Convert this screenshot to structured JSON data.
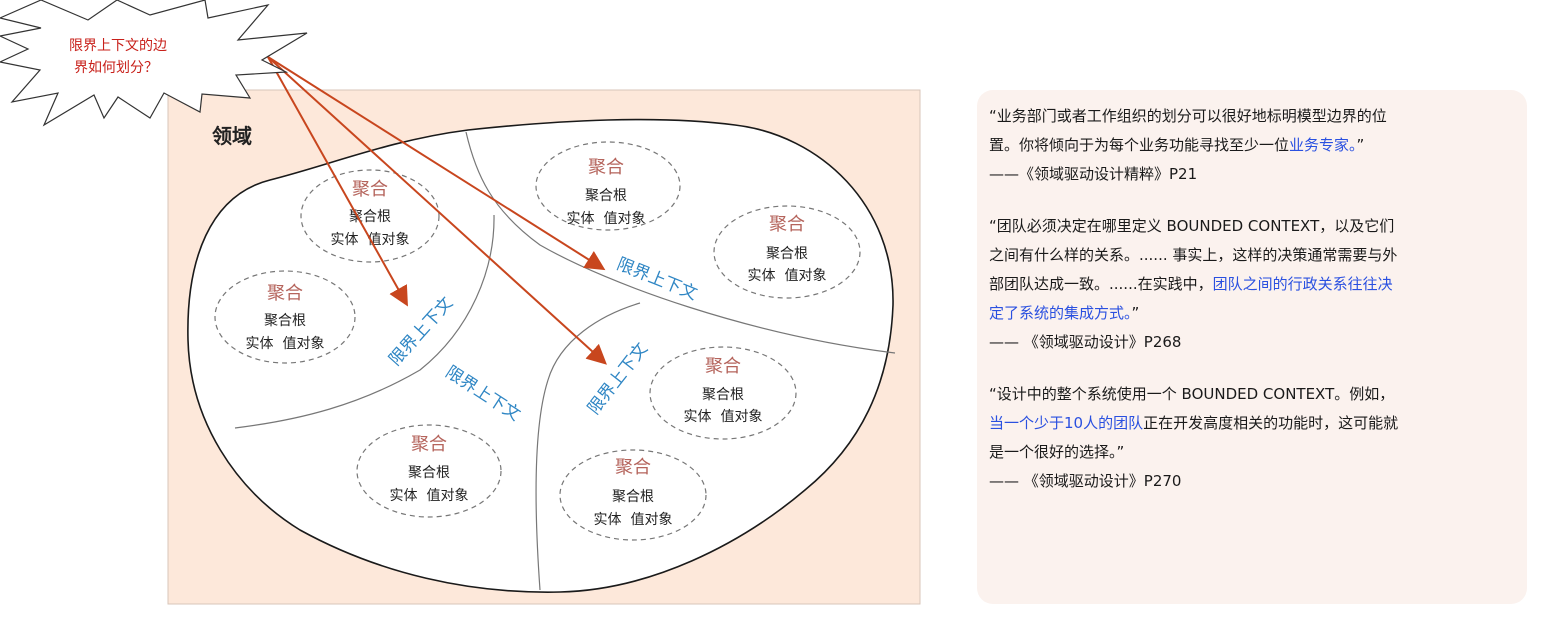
{
  "callout": {
    "lines": [
      "限界上下文的边",
      "界如何划分？"
    ]
  },
  "domain": {
    "label": "领域"
  },
  "aggregates": [
    {
      "title": "聚合",
      "root": "聚合根",
      "members": "实体  值对象"
    },
    {
      "title": "聚合",
      "root": "聚合根",
      "members": "实体  值对象"
    },
    {
      "title": "聚合",
      "root": "聚合根",
      "members": "实体  值对象"
    },
    {
      "title": "聚合",
      "root": "聚合根",
      "members": "实体  值对象"
    },
    {
      "title": "聚合",
      "root": "聚合根",
      "members": "实体  值对象"
    },
    {
      "title": "聚合",
      "root": "聚合根",
      "members": "实体  值对象"
    },
    {
      "title": "聚合",
      "root": "聚合根",
      "members": "实体  值对象"
    }
  ],
  "contexts": [
    "限界上下文",
    "限界上下文",
    "限界上下文",
    "限界上下文"
  ],
  "colors": {
    "domain_bg": "#fde8da",
    "arrow": "#c8461e",
    "aggregate_title": "#b5645c",
    "context_label": "#2f86c4",
    "callout_text": "#c8201a",
    "quote_highlight": "#2a50e0",
    "quote_panel_bg": "#fbf2ee"
  },
  "quotes": [
    {
      "lines": [
        [
          {
            "t": "“业务部门或者工作组织的划分可以很好地标明模型边界的位"
          }
        ],
        [
          {
            "t": "置。你将倾向于为每个业务功能寻找至少一位"
          },
          {
            "t": "业务专家。",
            "hl": true
          },
          {
            "t": "”"
          }
        ]
      ],
      "source": "——《领域驱动设计精粹》P21"
    },
    {
      "lines": [
        [
          {
            "t": "“团队必须决定在哪里定义 BOUNDED CONTEXT，以及它们"
          }
        ],
        [
          {
            "t": "之间有什么样的关系。...... 事实上，这样的决策通常需要与外"
          }
        ],
        [
          {
            "t": "部团队达成一致。......在实践中，"
          },
          {
            "t": "团队之间的行政关系往往决",
            "hl": true
          }
        ],
        [
          {
            "t": "定了系统的集成方式。",
            "hl": true
          },
          {
            "t": "”"
          }
        ]
      ],
      "source": "—— 《领域驱动设计》P268"
    },
    {
      "lines": [
        [
          {
            "t": "“设计中的整个系统使用一个 BOUNDED CONTEXT。例如，"
          }
        ],
        [
          {
            "t": "当一个少于10人的团队",
            "hl": true
          },
          {
            "t": "正在开发高度相关的功能时，这可能就"
          }
        ],
        [
          {
            "t": "是一个很好的选择。”"
          }
        ]
      ],
      "source": "—— 《领域驱动设计》P270"
    }
  ]
}
